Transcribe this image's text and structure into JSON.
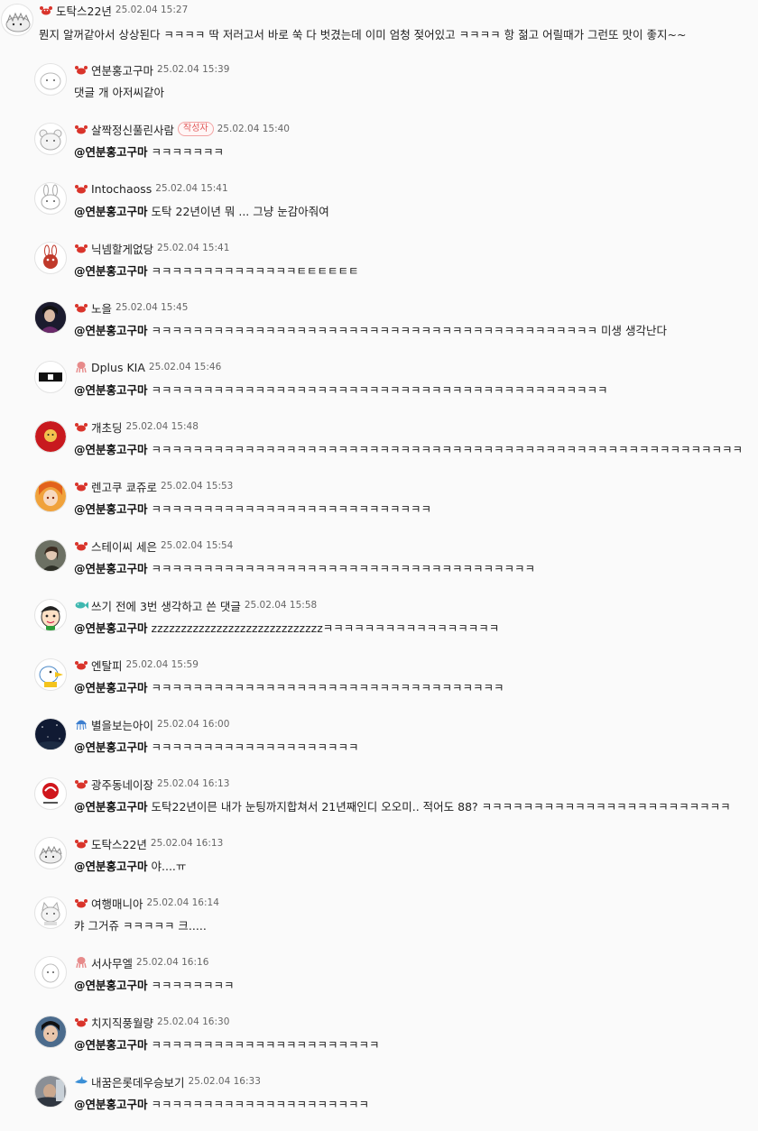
{
  "top_comment": {
    "nickname": "도탁스22년",
    "date": "25.02.04 15:27",
    "text": "뭔지 알꺼같아서 상상된다 ㅋㅋㅋㅋ 딱 저러고서 바로 쑥 다 벗겼는데 이미 엄청 젖어있고 ㅋㅋㅋㅋ 항 젊고 어릴때가 그런또 맛이 좋지~~",
    "badge_icon": "crab-icon",
    "avatar_icon": "hedgehog-icon"
  },
  "replies": [
    {
      "nickname": "연분홍고구마",
      "date": "25.02.04 15:39",
      "mention": "",
      "text": "댓글 개 아저씨같아",
      "badge_icon": "crab-icon",
      "avatar_icon": "blob-icon"
    },
    {
      "nickname": "살짝정신풀린사람",
      "author_tag": "작성자",
      "date": "25.02.04 15:40",
      "mention": "@연분홍고구마",
      "text": "ㅋㅋㅋㅋㅋㅋㅋ",
      "badge_icon": "crab-icon",
      "avatar_icon": "bear-icon"
    },
    {
      "nickname": "Intochaoss",
      "date": "25.02.04 15:41",
      "mention": "@연분홍고구마",
      "text": "도탁 22년이년 뭐 ... 그냥 눈감아줘여",
      "badge_icon": "crab-icon",
      "avatar_icon": "rabbit-icon"
    },
    {
      "nickname": "닉넴할게없당",
      "date": "25.02.04 15:41",
      "mention": "@연분홍고구마",
      "text": "ㅋㅋㅋㅋㅋㅋㅋㅋㅋㅋㅋㅋㅋㅋㅌㅌㅌㅌㅌㅌ",
      "badge_icon": "crab-icon",
      "avatar_icon": "red-rabbit-icon"
    },
    {
      "nickname": "노을",
      "date": "25.02.04 15:45",
      "mention": "@연분홍고구마",
      "text": "ㅋㅋㅋㅋㅋㅋㅋㅋㅋㅋㅋㅋㅋㅋㅋㅋㅋㅋㅋㅋㅋㅋㅋㅋㅋㅋㅋㅋㅋㅋㅋㅋㅋㅋㅋㅋㅋㅋㅋㅋㅋㅋㅋ 미생 생각난다",
      "badge_icon": "crab-icon",
      "avatar_icon": "photo-avatar-icon"
    },
    {
      "nickname": "Dplus KIA",
      "date": "25.02.04 15:46",
      "mention": "@연분홍고구마",
      "text": "ㅋㅋㅋㅋㅋㅋㅋㅋㅋㅋㅋㅋㅋㅋㅋㅋㅋㅋㅋㅋㅋㅋㅋㅋㅋㅋㅋㅋㅋㅋㅋㅋㅋㅋㅋㅋㅋㅋㅋㅋㅋㅋㅋㅋ",
      "badge_icon": "octopus-icon",
      "avatar_icon": "team-logo-icon"
    },
    {
      "nickname": "개초딩",
      "date": "25.02.04 15:48",
      "mention": "@연분홍고구마",
      "text": "ㅋㅋㅋㅋㅋㅋㅋㅋㅋㅋㅋㅋㅋㅋㅋㅋㅋㅋㅋㅋㅋㅋㅋㅋㅋㅋㅋㅋㅋㅋㅋㅋㅋㅋㅋㅋㅋㅋㅋㅋㅋㅋㅋㅋㅋㅋㅋㅋㅋㅋㅋㅋㅋㅋㅋㅋㅋ",
      "badge_icon": "crab-icon",
      "avatar_icon": "red-mascot-icon"
    },
    {
      "nickname": "렌고쿠 쿄쥬로",
      "date": "25.02.04 15:53",
      "mention": "@연분홍고구마",
      "text": "ㅋㅋㅋㅋㅋㅋㅋㅋㅋㅋㅋㅋㅋㅋㅋㅋㅋㅋㅋㅋㅋㅋㅋㅋㅋㅋㅋ",
      "badge_icon": "crab-icon",
      "avatar_icon": "anime-avatar-icon"
    },
    {
      "nickname": "스테이씨 세은",
      "date": "25.02.04 15:54",
      "mention": "@연분홍고구마",
      "text": "ㅋㅋㅋㅋㅋㅋㅋㅋㅋㅋㅋㅋㅋㅋㅋㅋㅋㅋㅋㅋㅋㅋㅋㅋㅋㅋㅋㅋㅋㅋㅋㅋㅋㅋㅋㅋㅋ",
      "badge_icon": "crab-icon",
      "avatar_icon": "photo-avatar-icon"
    },
    {
      "nickname": "쓰기 전에 3번 생각하고 쓴 댓글",
      "date": "25.02.04 15:58",
      "mention": "@연분홍고구마",
      "text": "zzzzzzzzzzzzzzzzzzzzzzzzzzzzzㅋㅋㅋㅋㅋㅋㅋㅋㅋㅋㅋㅋㅋㅋㅋㅋㅋ",
      "badge_icon": "fish-icon",
      "avatar_icon": "cartoon-boy-icon"
    },
    {
      "nickname": "엔탈피",
      "date": "25.02.04 15:59",
      "mention": "@연분홍고구마",
      "text": "ㅋㅋㅋㅋㅋㅋㅋㅋㅋㅋㅋㅋㅋㅋㅋㅋㅋㅋㅋㅋㅋㅋㅋㅋㅋㅋㅋㅋㅋㅋㅋㅋㅋㅋ",
      "badge_icon": "crab-icon",
      "avatar_icon": "bird-icon"
    },
    {
      "nickname": "별을보는아이",
      "date": "25.02.04 16:00",
      "mention": "@연분홍고구마",
      "text": "ㅋㅋㅋㅋㅋㅋㅋㅋㅋㅋㅋㅋㅋㅋㅋㅋㅋㅋㅋㅋ",
      "badge_icon": "jellyfish-icon",
      "avatar_icon": "night-sky-icon"
    },
    {
      "nickname": "광주동네이장",
      "date": "25.02.04 16:13",
      "mention": "@연분홍고구마",
      "text": "도탁22년이믄 내가 눈팅까지합쳐서 21년째인디 오오미.. 적어도 88? ㅋㅋㅋㅋㅋㅋㅋㅋㅋㅋㅋㅋㅋㅋㅋㅋㅋㅋㅋㅋㅋㅋㅋㅋ",
      "badge_icon": "crab-icon",
      "avatar_icon": "red-logo-icon"
    },
    {
      "nickname": "도탁스22년",
      "date": "25.02.04 16:13",
      "mention": "@연분홍고구마",
      "text": "야....ㅠ",
      "badge_icon": "crab-icon",
      "avatar_icon": "hedgehog-icon"
    },
    {
      "nickname": "여행매니아",
      "date": "25.02.04 16:14",
      "mention": "",
      "text": "캬 그거쥬 ㅋㅋㅋㅋㅋ 크.....",
      "badge_icon": "crab-icon",
      "avatar_icon": "cat-icon"
    },
    {
      "nickname": "서사무엘",
      "date": "25.02.04 16:16",
      "mention": "@연분홍고구마",
      "text": "ㅋㅋㅋㅋㅋㅋㅋㅋ",
      "badge_icon": "octopus-icon",
      "avatar_icon": "blob-icon"
    },
    {
      "nickname": "치지직풍월량",
      "date": "25.02.04 16:30",
      "mention": "@연분홍고구마",
      "text": "ㅋㅋㅋㅋㅋㅋㅋㅋㅋㅋㅋㅋㅋㅋㅋㅋㅋㅋㅋㅋㅋㅋ",
      "badge_icon": "crab-icon",
      "avatar_icon": "photo-avatar-icon"
    },
    {
      "nickname": "내꿈은롯데우승보기",
      "date": "25.02.04 16:33",
      "mention": "@연분홍고구마",
      "text": "ㅋㅋㅋㅋㅋㅋㅋㅋㅋㅋㅋㅋㅋㅋㅋㅋㅋㅋㅋㅋㅋ",
      "badge_icon": "shark-icon",
      "avatar_icon": "photo-avatar-icon"
    }
  ]
}
